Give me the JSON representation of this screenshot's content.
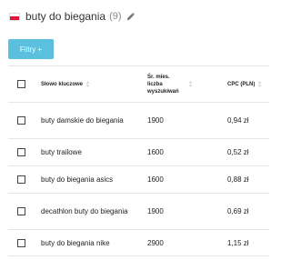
{
  "header": {
    "title": "buty do biegania",
    "count": "(9)"
  },
  "toolbar": {
    "filter_label": "Filtry +"
  },
  "table": {
    "columns": {
      "keyword": "Słowo kluczowe",
      "volume": "Śr. mies. liczba wyszukiwań",
      "cpc": "CPC (PLN)"
    },
    "rows": [
      {
        "keyword": "buty damskie do biegania",
        "volume": "1900",
        "cpc": "0,94 zł"
      },
      {
        "keyword": "buty trailowe",
        "volume": "1600",
        "cpc": "0,52 zł"
      },
      {
        "keyword": "buty do biegania asics",
        "volume": "1600",
        "cpc": "0,88 zł"
      },
      {
        "keyword": "decathlon buty do biegania",
        "volume": "1900",
        "cpc": "0,69 zł"
      },
      {
        "keyword": "buty do biegania nike",
        "volume": "2900",
        "cpc": "1,15 zł"
      }
    ]
  },
  "colors": {
    "accent": "#5bc0de",
    "flag_red": "#dc143c"
  }
}
